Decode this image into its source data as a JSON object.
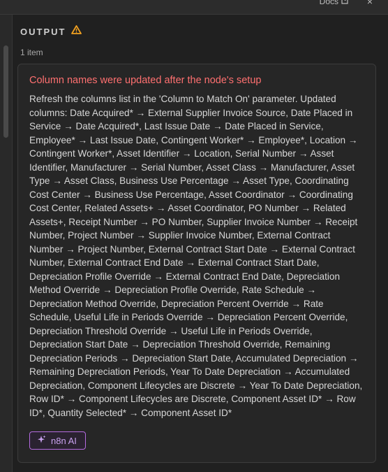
{
  "topbar": {
    "docs_label": "Docs",
    "close_glyph": "×"
  },
  "output": {
    "title": "OUTPUT",
    "warning_icon": "warning-triangle-icon",
    "item_count": "1 item"
  },
  "error": {
    "title": "Column names were updated after the node's setup",
    "message": "Refresh the columns list in the 'Column to Match On' parameter. Updated columns: Date Acquired* → External Supplier Invoice Source, Date Placed in Service → Date Acquired*, Last Issue Date → Date Placed in Service, Employee* → Last Issue Date, Contingent Worker* → Employee*, Location → Contingent Worker*, Asset Identifier → Location, Serial Number → Asset Identifier, Manufacturer → Serial Number, Asset Class → Manufacturer, Asset Type → Asset Class, Business Use Percentage → Asset Type, Coordinating Cost Center → Business Use Percentage, Asset Coordinator → Coordinating Cost Center, Related Assets+ → Asset Coordinator, PO Number → Related Assets+, Receipt Number → PO Number, Supplier Invoice Number → Receipt Number, Project Number → Supplier Invoice Number, External Contract Number → Project Number, External Contract Start Date → External Contract Number, External Contract End Date → External Contract Start Date, Depreciation Profile Override → External Contract End Date, Depreciation Method Override → Depreciation Profile Override, Rate Schedule → Depreciation Method Override, Depreciation Percent Override → Rate Schedule, Useful Life in Periods Override → Depreciation Percent Override, Depreciation Threshold Override → Useful Life in Periods Override, Depreciation Start Date → Depreciation Threshold Override, Remaining Depreciation Periods → Depreciation Start Date, Accumulated Depreciation → Remaining Depreciation Periods, Year To Date Depreciation → Accumulated Depreciation, Component Lifecycles are Discrete → Year To Date Depreciation, Row ID* → Component Lifecycles are Discrete, Component Asset ID* → Row ID*, Quantity Selected* → Component Asset ID*"
  },
  "ai_button": {
    "label": "n8n AI",
    "icon": "sparkle-icon"
  },
  "colors": {
    "background": "#202020",
    "error_title": "#ff7070",
    "warning": "#f0a020",
    "ai_accent": "#b56be0"
  }
}
